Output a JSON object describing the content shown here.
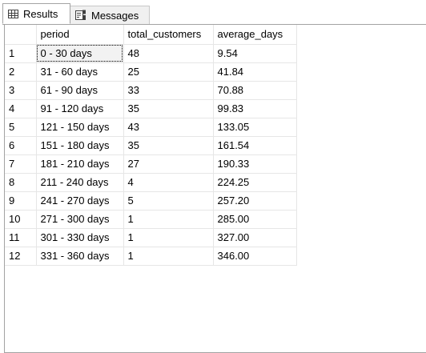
{
  "tabs": {
    "results_label": "Results",
    "messages_label": "Messages"
  },
  "grid": {
    "columns": [
      "",
      "period",
      "total_customers",
      "average_days"
    ],
    "rows": [
      {
        "n": "1",
        "period": "0 - 30 days",
        "total_customers": "48",
        "average_days": "9.54"
      },
      {
        "n": "2",
        "period": "31 - 60 days",
        "total_customers": "25",
        "average_days": "41.84"
      },
      {
        "n": "3",
        "period": "61 - 90 days",
        "total_customers": "33",
        "average_days": "70.88"
      },
      {
        "n": "4",
        "period": "91 - 120 days",
        "total_customers": "35",
        "average_days": "99.83"
      },
      {
        "n": "5",
        "period": "121 - 150 days",
        "total_customers": "43",
        "average_days": "133.05"
      },
      {
        "n": "6",
        "period": "151 - 180 days",
        "total_customers": "35",
        "average_days": "161.54"
      },
      {
        "n": "7",
        "period": "181 - 210 days",
        "total_customers": "27",
        "average_days": "190.33"
      },
      {
        "n": "8",
        "period": "211 - 240 days",
        "total_customers": "4",
        "average_days": "224.25"
      },
      {
        "n": "9",
        "period": "241 - 270 days",
        "total_customers": "5",
        "average_days": "257.20"
      },
      {
        "n": "10",
        "period": "271 - 300 days",
        "total_customers": "1",
        "average_days": "285.00"
      },
      {
        "n": "11",
        "period": "301 - 330 days",
        "total_customers": "1",
        "average_days": "327.00"
      },
      {
        "n": "12",
        "period": "331 - 360 days",
        "total_customers": "1",
        "average_days": "346.00"
      }
    ]
  }
}
